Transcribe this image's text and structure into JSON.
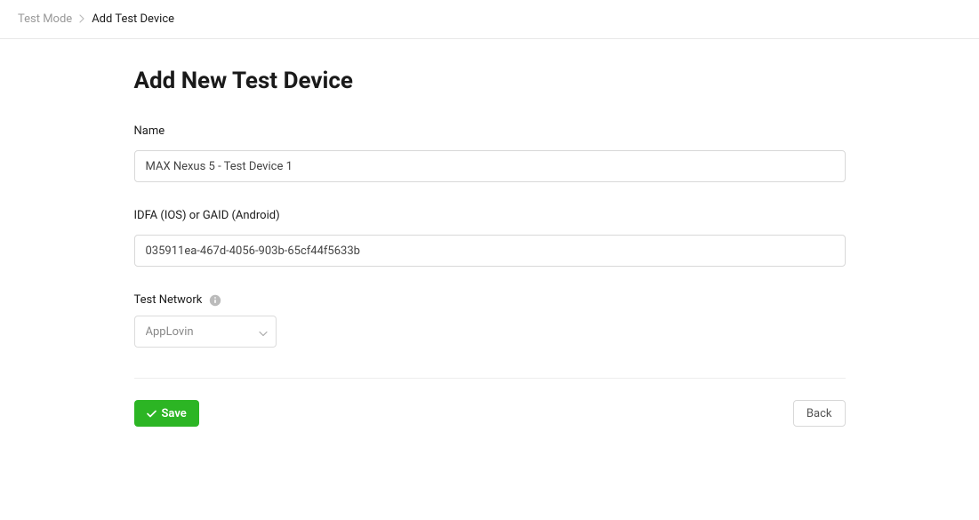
{
  "breadcrumb": {
    "parent": "Test Mode",
    "current": "Add Test Device"
  },
  "page": {
    "title": "Add New Test Device"
  },
  "form": {
    "name_label": "Name",
    "name_value": "MAX Nexus 5 - Test Device 1",
    "idfa_label": "IDFA (IOS) or GAID (Android)",
    "idfa_value": "035911ea-467d-4056-903b-65cf44f5633b",
    "network_label": "Test Network",
    "network_selected": "AppLovin"
  },
  "actions": {
    "save_label": "Save",
    "back_label": "Back"
  }
}
